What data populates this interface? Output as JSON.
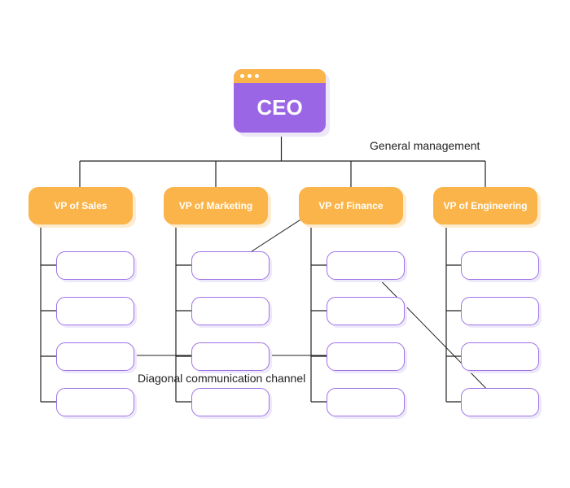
{
  "ceo": {
    "label": "CEO"
  },
  "vps": [
    {
      "label": "VP of Sales",
      "sub_boxes": 4
    },
    {
      "label": "VP of Marketing",
      "sub_boxes": 4
    },
    {
      "label": "VP of Finance",
      "sub_boxes": 4
    },
    {
      "label": "VP of Engineering",
      "sub_boxes": 4
    }
  ],
  "annotations": {
    "general": "General management",
    "diagonal": "Diagonal communication channel"
  },
  "colors": {
    "ceo_body": "#9b66e6",
    "header_orange": "#fbb449",
    "sub_border": "#9e72e6",
    "line": "#222222"
  }
}
